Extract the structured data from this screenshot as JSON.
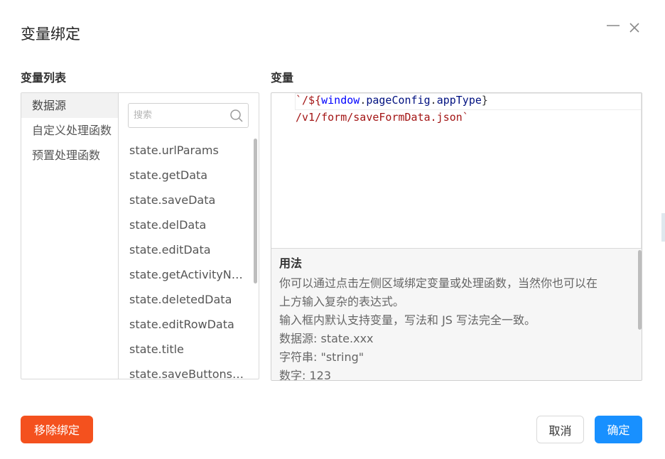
{
  "dialog": {
    "title": "变量绑定",
    "minimize_icon": "minimize-icon",
    "close_icon": "close-icon"
  },
  "variable_list": {
    "label": "变量列表",
    "categories": [
      {
        "label": "数据源",
        "active": true
      },
      {
        "label": "自定义处理函数",
        "active": false
      },
      {
        "label": "预置处理函数",
        "active": false
      }
    ],
    "search": {
      "placeholder": "搜索",
      "value": "",
      "icon": "search-icon"
    },
    "items": [
      "state.urlParams",
      "state.getData",
      "state.saveData",
      "state.delData",
      "state.editData",
      "state.getActivityNodeList",
      "state.deletedData",
      "state.editRowData",
      "state.title",
      "state.saveButtonsList"
    ]
  },
  "variable": {
    "label": "变量",
    "code": {
      "line1_prefix": "`/${",
      "line1_window": "window",
      "line1_dot1": ".",
      "line1_page": "pageConfig",
      "line1_dot2": ".",
      "line1_app": "appType",
      "line1_suffix": "}",
      "line2": "/v1/form/saveFormData.json`"
    },
    "help": {
      "title": "用法",
      "lines": [
        "你可以通过点击左侧区域绑定变量或处理函数，当然你也可以在",
        "上方输入复杂的表达式。",
        "输入框内默认支持变量，写法和 JS 写法完全一致。",
        "数据源: state.xxx",
        "字符串: \"string\"",
        "数字: 123"
      ]
    }
  },
  "footer": {
    "remove_label": "移除绑定",
    "cancel_label": "取消",
    "ok_label": "确定"
  },
  "colors": {
    "primary": "#1890ff",
    "danger": "#f4511e",
    "string": "#a31515",
    "keyword": "#0000ff"
  }
}
